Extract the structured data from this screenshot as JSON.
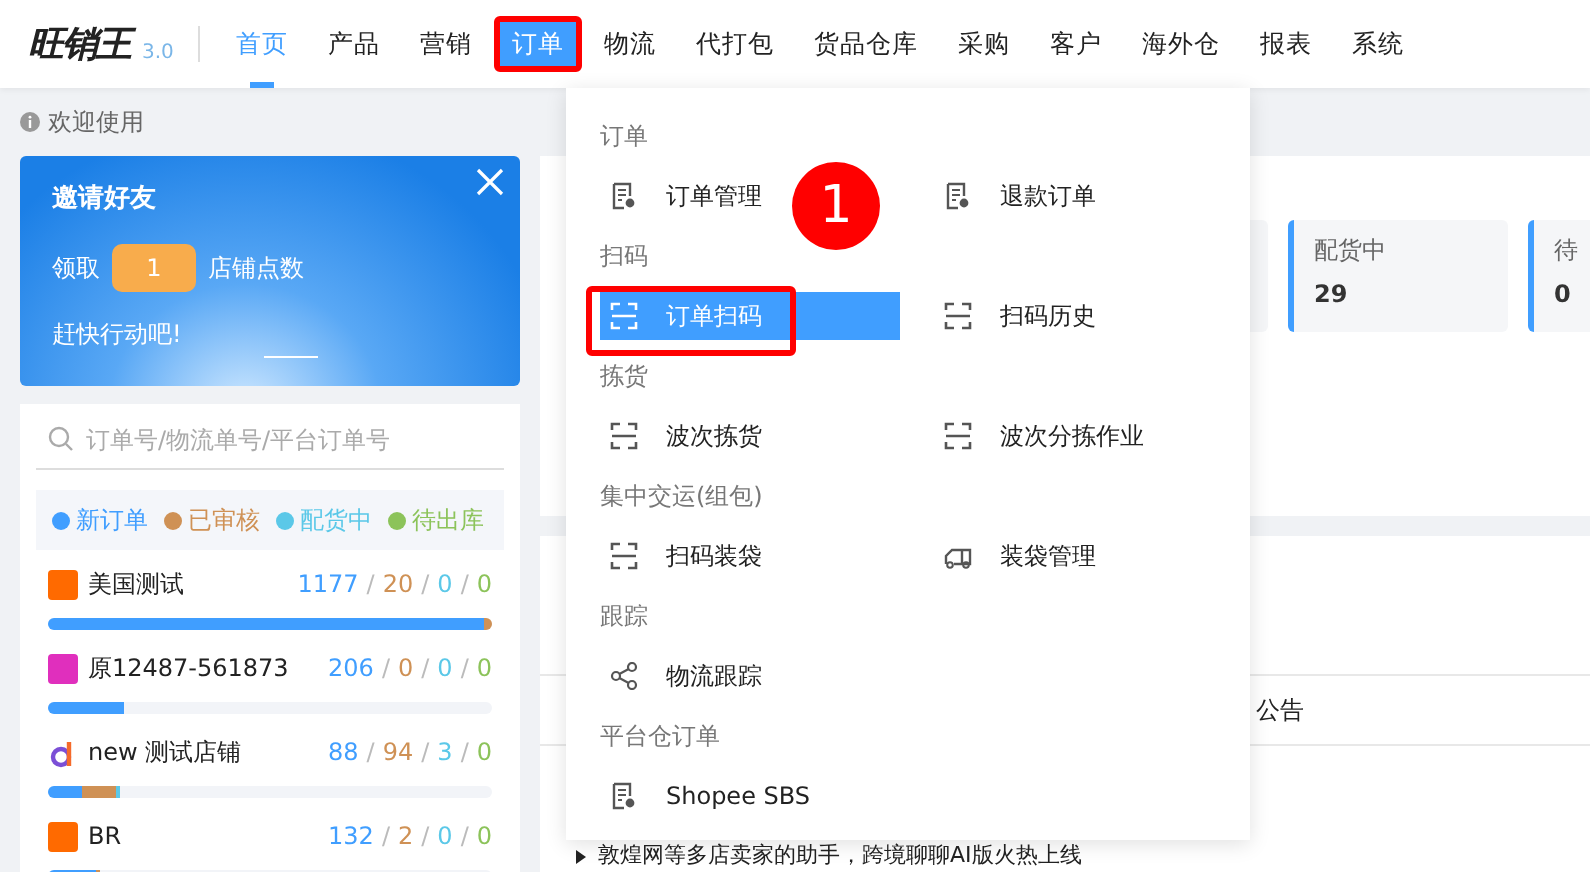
{
  "logo": {
    "name": "旺销王",
    "version": "3.0"
  },
  "nav": [
    {
      "label": "首页",
      "selected": true,
      "open": false,
      "annotated": false
    },
    {
      "label": "产品",
      "selected": false,
      "open": false,
      "annotated": false
    },
    {
      "label": "营销",
      "selected": false,
      "open": false,
      "annotated": false
    },
    {
      "label": "订单",
      "selected": false,
      "open": true,
      "annotated": true
    },
    {
      "label": "物流",
      "selected": false,
      "open": false,
      "annotated": false
    },
    {
      "label": "代打包",
      "selected": false,
      "open": false,
      "annotated": false
    },
    {
      "label": "货品仓库",
      "selected": false,
      "open": false,
      "annotated": false
    },
    {
      "label": "采购",
      "selected": false,
      "open": false,
      "annotated": false
    },
    {
      "label": "客户",
      "selected": false,
      "open": false,
      "annotated": false
    },
    {
      "label": "海外仓",
      "selected": false,
      "open": false,
      "annotated": false
    },
    {
      "label": "报表",
      "selected": false,
      "open": false,
      "annotated": false
    },
    {
      "label": "系统",
      "selected": false,
      "open": false,
      "annotated": false
    }
  ],
  "welcome": "欢迎使用",
  "invite_banner": {
    "title": "邀请好友",
    "prefix": "领取",
    "points": "1",
    "suffix": "店铺点数",
    "cta": "赶快行动吧!"
  },
  "search": {
    "placeholder": "订单号/物流单号/平台订单号"
  },
  "legend": [
    {
      "label": "新订单",
      "color": "#409eff"
    },
    {
      "label": "已审核",
      "color": "#cf9155"
    },
    {
      "label": "配货中",
      "color": "#5bc8e8"
    },
    {
      "label": "待出库",
      "color": "#8cc35a"
    }
  ],
  "shops": [
    {
      "name": "美国测试",
      "icon": {
        "kind": "tile",
        "color": "#ff6a00"
      },
      "counts": [
        "1177",
        "/",
        "20",
        "/",
        "0",
        "/",
        "0"
      ],
      "segments": [
        {
          "level": 0.98
        },
        {
          "level": 0.02
        }
      ]
    },
    {
      "name": "原12487-561873",
      "icon": {
        "kind": "tile",
        "color": "#e02fbd"
      },
      "counts": [
        "206",
        "/",
        "0",
        "/",
        "0",
        "/",
        "0"
      ],
      "segments": [
        {
          "level": 0.17
        }
      ]
    },
    {
      "name": "new 测试店铺",
      "icon": {
        "kind": "letter",
        "color": "#7b4fd6"
      },
      "counts": [
        "88",
        "/",
        "94",
        "/",
        "3",
        "/",
        "0"
      ],
      "segments": [
        {
          "level": 0.075
        },
        {
          "level": 0.08
        },
        {
          "level": 0.005
        }
      ]
    },
    {
      "name": "BR",
      "icon": {
        "kind": "tile",
        "color": "#ff6a00"
      },
      "counts": [
        "132",
        "/",
        "2",
        "/",
        "0",
        "/",
        "0"
      ],
      "segments": [
        {
          "level": 0.11
        },
        {
          "level": 0.005
        }
      ]
    }
  ],
  "stat_cards": [
    {
      "label": "配货中",
      "value": "29"
    },
    {
      "label": "待",
      "value": "0"
    }
  ],
  "notices": [
    "公告"
  ],
  "news": "敦煌网等多店卖家的助手，跨境聊聊AI版火热上线",
  "menu": [
    {
      "title": "订单",
      "items": [
        {
          "label": "订单管理",
          "kind": "doc",
          "selected": false,
          "annotated": false
        },
        {
          "label": "退款订单",
          "kind": "doc",
          "selected": false,
          "annotated": false
        }
      ]
    },
    {
      "title": "扫码",
      "items": [
        {
          "label": "订单扫码",
          "kind": "scan",
          "selected": true,
          "annotated": true
        },
        {
          "label": "扫码历史",
          "kind": "scan",
          "selected": false,
          "annotated": false
        }
      ]
    },
    {
      "title": "拣货",
      "items": [
        {
          "label": "波次拣货",
          "kind": "scan",
          "selected": false,
          "annotated": false
        },
        {
          "label": "波次分拣作业",
          "kind": "scan",
          "selected": false,
          "annotated": false
        }
      ]
    },
    {
      "title": "集中交运(组包)",
      "items": [
        {
          "label": "扫码装袋",
          "kind": "scan",
          "selected": false,
          "annotated": false
        },
        {
          "label": "装袋管理",
          "kind": "truck",
          "selected": false,
          "annotated": false
        }
      ]
    },
    {
      "title": "跟踪",
      "items": [
        {
          "label": "物流跟踪",
          "kind": "share",
          "selected": false,
          "annotated": false
        }
      ]
    },
    {
      "title": "平台仓订单",
      "items": [
        {
          "label": "Shopee SBS",
          "kind": "doc",
          "selected": false,
          "annotated": false
        }
      ]
    }
  ],
  "step_badge": "1"
}
